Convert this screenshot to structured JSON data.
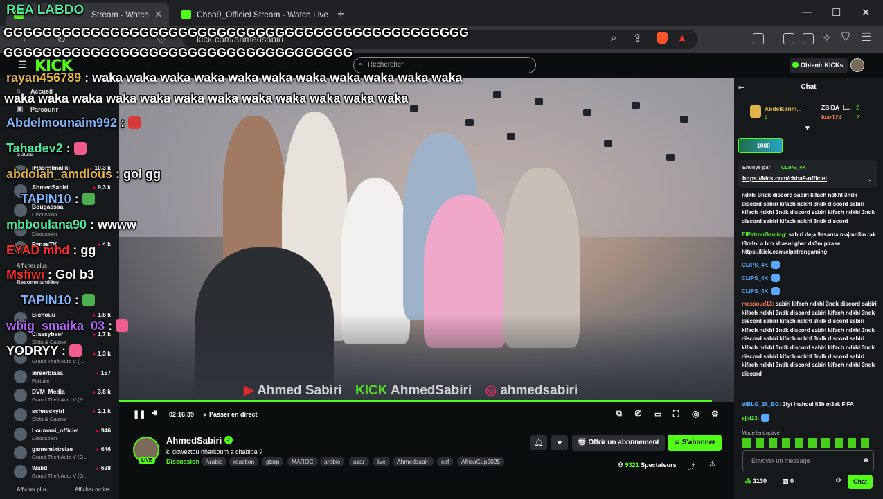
{
  "browser": {
    "tabs": [
      {
        "label": "Stream - Watch"
      },
      {
        "label": "Chba9_Officiel Stream - Watch Live o"
      }
    ],
    "url": "kick.com/anmedsabiri",
    "window_controls": [
      "—",
      "☐",
      "✕"
    ]
  },
  "kick": {
    "logo": "KICK",
    "search_placeholder": "Rechercher",
    "obtenir_kicks": "Obtenir KICKs"
  },
  "sidebar": {
    "nav": [
      "Accueil",
      "Parcourir"
    ],
    "suivis_label": "Suivis",
    "afficher_plus_1": "Afficher plus",
    "recommandees_label": "Recommandées",
    "afficher_plus_2": "Afficher plus",
    "afficher_moins": "Afficher moins",
    "followed": [
      {
        "name": "ilyasselmaliki",
        "category": "",
        "viewers": "10,3 k"
      },
      {
        "name": "AhmedSabiri",
        "category": "",
        "viewers": "9,3 k"
      },
      {
        "name": "Bougassaa",
        "category": "Discussion",
        "viewers": ""
      },
      {
        "name": "",
        "category": "Discussion",
        "viewers": ""
      },
      {
        "name": "PanasTV",
        "category": "",
        "viewers": "4 k"
      }
    ],
    "recommended": [
      {
        "name": "Bichouu",
        "category": "",
        "viewers": "1,8 k"
      },
      {
        "name": "Classybeef",
        "category": "Slots & Casino",
        "viewers": "1,7 k"
      },
      {
        "name": "",
        "category": "Grand Theft Auto V (...",
        "viewers": "1,3 k"
      },
      {
        "name": "airserbiaaa",
        "category": "Fortnite",
        "viewers": "157"
      },
      {
        "name": "DVM_Medja",
        "category": "Grand Theft Auto V (R...",
        "viewers": "3,8 k"
      },
      {
        "name": "schneckyirl",
        "category": "Slots & Casino",
        "viewers": "2,1 k"
      },
      {
        "name": "Loumani_officiel",
        "category": "Discussion",
        "viewers": "946"
      },
      {
        "name": "gamemixtreize",
        "category": "Grand Theft Auto V (G...",
        "viewers": "646"
      },
      {
        "name": "Walid",
        "category": "Grand Theft Auto V (G...",
        "viewers": "638"
      }
    ]
  },
  "player": {
    "time": "02:16:39",
    "live_label": "Passer en direct",
    "watermark": {
      "yt": "Ahmed Sabiri",
      "kick": "KICK",
      "kick_name": "AhmedSabiri",
      "ig": "ahmedsabiri"
    }
  },
  "channel": {
    "name": "AhmedSabiri",
    "live": "LIVE",
    "title": "ki doweztou nharkoum a chabiba ?",
    "category": "Discussion",
    "tags": [
      "Arabic",
      "reaction",
      "gtarp",
      "MAROC",
      "arabic",
      "azar",
      "live",
      "Ahmedsabiri",
      "caf",
      "AfricaCup2025"
    ],
    "offrir": "Offrir un abonnement",
    "sabonner": "S'abonner",
    "viewers": "9321",
    "viewers_label": "Spectateurs"
  },
  "chat": {
    "title": "Chat",
    "top_gifters": [
      {
        "name": "Abdelkarim...",
        "count": "4"
      },
      {
        "name": "ZBIDA_L...",
        "count": "2"
      },
      {
        "name": "Ivar124",
        "count": "2"
      }
    ],
    "kicks_1000": "1000",
    "pinned_sender_label": "Envoyé par",
    "pinned_sender": "CLIPS_4K",
    "pinned_link": "https://kick.com/chba9-officiel",
    "messages": [
      {
        "user": "",
        "text": "ndkhi 3ndk discord sabiri kifach ndkhl 3ndk discord sabiri kifach ndkhl 3ndk discord sabiri kifach ndkhl 3ndk discord sabiri kifach ndkhl 3ndk discord sabiri kifach ndkhl 3ndk discord"
      },
      {
        "user": "ElPatronGaming:",
        "text": "sabiri deja 9asarna majmo3in rak t3rafni a bro khasni gher da3m pirase https://kick.com/elpatrongaming"
      },
      {
        "user": "CLIPS_4K:",
        "text": ""
      },
      {
        "user": "CLIPS_4K:",
        "text": ""
      },
      {
        "user": "CLIPS_4K:",
        "text": ""
      },
      {
        "user": "massoud13:",
        "text": "sabiri kifach ndkhl 3ndk discord sabiri kifach ndkhl 3ndk discord sabiri kifach ndkhl 3ndk discord sabiri kifach ndkhl 3ndk discord sabiri kifach ndkhl 3ndk discord sabiri kifach ndkhl 3ndk discord sabiri kifach ndkhl 3ndk discord sabiri kifach ndkhl 3ndk discord sabiri kifach ndkhl 3ndk discord sabiri kifach ndkhl 3ndk discord sabiri kifach ndkhl 3ndk discord sabiri kifach ndkhl 3ndk discord"
      },
      {
        "user": "WBLG_26_BG:",
        "text": "3lyt lnahoul li3b m3ak FIFA"
      },
      {
        "user": "ejjd23:",
        "text": ""
      }
    ],
    "slow_mode": "Mode lent activé",
    "input_placeholder": "Envoyer un message",
    "points": "1130",
    "zero": "0",
    "send": "Chat"
  },
  "overlay": [
    {
      "user": "REA LABDO",
      "text": ""
    },
    {
      "user": "",
      "text": "GGGGGGGGGGGGGGGGGGGGGGGGGGGGGGGGGGGGGGGGGGGGGGGG"
    },
    {
      "user": "",
      "text": "GGGGGGGGGGGGGGGGGGGGGGGGGGGGGGGGGGGG"
    },
    {
      "user": "rayan456789",
      "text": ": waka waka waka waka waka waka waka waka waka waka waka"
    },
    {
      "user": "",
      "text": "waka waka waka waka waka waka waka waka waka waka waka waka"
    },
    {
      "user": "Abdelmounaim992",
      "text": ":"
    },
    {
      "user": "Tahadev2",
      "text": ":"
    },
    {
      "user": "abdolah_amdlous",
      "text": ": gol gg"
    },
    {
      "user": "TAPIN10",
      "text": ":"
    },
    {
      "user": "mbboulana90",
      "text": ": wwww"
    },
    {
      "user": "EYAD mhd",
      "text": ": gg"
    },
    {
      "user": "Msfiwi",
      "text": ": Gol b3"
    },
    {
      "user": "TAPIN10",
      "text": ":"
    },
    {
      "user": "wbig_smaika_03",
      "text": ":"
    },
    {
      "user": "YODRYY",
      "text": ":"
    }
  ],
  "colors": {
    "accent": "#53fc18",
    "bg": "#0b0e0f",
    "panel": "#16191c"
  }
}
